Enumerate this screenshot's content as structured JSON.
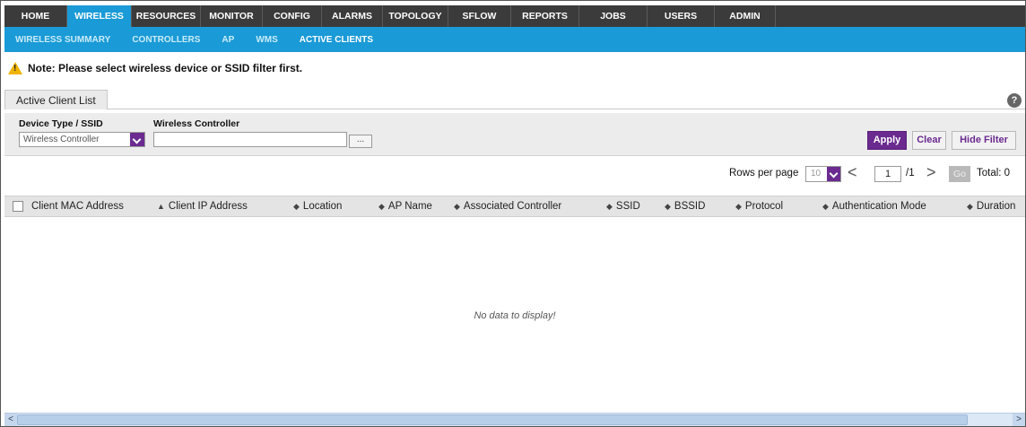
{
  "topnav": {
    "tabs": [
      {
        "label": "HOME",
        "active": false
      },
      {
        "label": "WIRELESS",
        "active": true
      },
      {
        "label": "RESOURCES",
        "active": false
      },
      {
        "label": "MONITOR",
        "active": false
      },
      {
        "label": "CONFIG",
        "active": false
      },
      {
        "label": "ALARMS",
        "active": false
      },
      {
        "label": "TOPOLOGY",
        "active": false
      },
      {
        "label": "SFLOW",
        "active": false
      },
      {
        "label": "REPORTS",
        "active": false
      },
      {
        "label": "JOBS",
        "active": false
      },
      {
        "label": "USERS",
        "active": false
      },
      {
        "label": "ADMIN",
        "active": false
      }
    ]
  },
  "subnav": {
    "items": [
      {
        "label": "WIRELESS SUMMARY",
        "active": false
      },
      {
        "label": "CONTROLLERS",
        "active": false
      },
      {
        "label": "AP",
        "active": false
      },
      {
        "label": "WMS",
        "active": false
      },
      {
        "label": "ACTIVE CLIENTS",
        "active": true
      }
    ]
  },
  "note": {
    "icon": "warning-icon",
    "text": "Note: Please select wireless device or SSID filter first."
  },
  "list_tab": {
    "label": "Active Client List",
    "help_icon": "help-icon",
    "help_glyph": "?"
  },
  "filter": {
    "device_type_label": "Device Type / SSID",
    "device_type_value": "Wireless Controller",
    "wireless_controller_label": "Wireless Controller",
    "wireless_controller_value": "",
    "browse_label": "...",
    "apply_label": "Apply",
    "clear_label": "Clear",
    "hide_filter_label": "Hide Filter"
  },
  "pager": {
    "rows_per_page_label": "Rows per page",
    "rows_per_page_value": "10",
    "prev_glyph": "<",
    "current_page": "1",
    "of_pages": "/1",
    "next_glyph": ">",
    "go_label": "Go",
    "total_label": "Total: 0"
  },
  "table": {
    "columns": [
      {
        "label": "Client MAC Address",
        "sort": ""
      },
      {
        "label": "Client IP Address",
        "sort": "▲"
      },
      {
        "label": "Location",
        "sort": "◆"
      },
      {
        "label": "AP Name",
        "sort": "◆"
      },
      {
        "label": "Associated Controller",
        "sort": "◆"
      },
      {
        "label": "SSID",
        "sort": "◆"
      },
      {
        "label": "BSSID",
        "sort": "◆"
      },
      {
        "label": "Protocol",
        "sort": "◆"
      },
      {
        "label": "Authentication Mode",
        "sort": "◆"
      },
      {
        "label": "Duration",
        "sort": "◆"
      }
    ],
    "empty_message": "No data to display!"
  },
  "scrollbar": {
    "left_glyph": "<",
    "right_glyph": ">"
  },
  "colors": {
    "nav_dark": "#3b3b3b",
    "nav_blue": "#1a9ad6",
    "accent_purple": "#6a2a8f"
  }
}
